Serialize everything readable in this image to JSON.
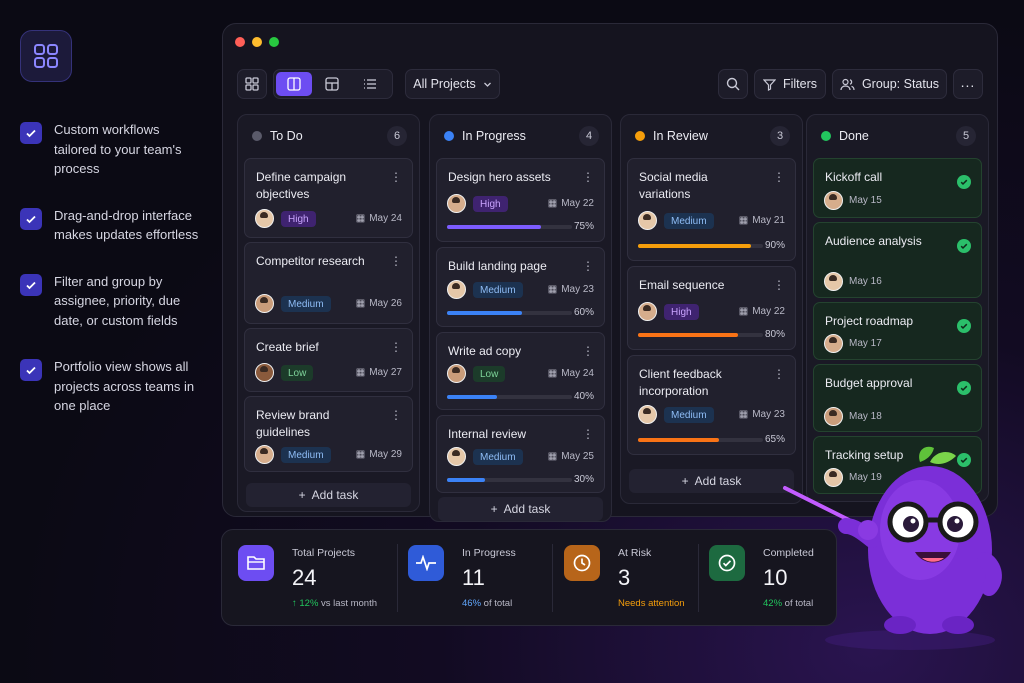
{
  "features": [
    {
      "text": "Custom workflows tailored to your team's process"
    },
    {
      "text": "Drag-and-drop interface makes updates effortless"
    },
    {
      "text": "Filter and group by assignee, priority, due date, or custom fields"
    },
    {
      "text": "Portfolio view shows all projects across teams in one place"
    }
  ],
  "toolbar": {
    "project_select": "All Projects",
    "filters_label": "Filters",
    "group_label": "Group: Status"
  },
  "columns": [
    {
      "title": "To Do",
      "count": "6",
      "color": "#5a5a6a",
      "add_label": "Add task",
      "cards": [
        {
          "title": "Define campaign objectives",
          "priority": "High",
          "due": "May 24"
        },
        {
          "title": "Competitor research",
          "priority": "Medium",
          "due": "May 26"
        },
        {
          "title": "Create brief",
          "priority": "Low",
          "due": "May 27"
        },
        {
          "title": "Review brand guidelines",
          "priority": "Medium",
          "due": "May 29"
        }
      ]
    },
    {
      "title": "In Progress",
      "count": "4",
      "color": "#3b82f6",
      "add_label": "Add task",
      "cards": [
        {
          "title": "Design hero assets",
          "priority": "High",
          "due": "May 22",
          "progress": "75%"
        },
        {
          "title": "Build landing page",
          "priority": "Medium",
          "due": "May 23",
          "progress": "60%"
        },
        {
          "title": "Write ad copy",
          "priority": "Low",
          "due": "May 24",
          "progress": "40%"
        },
        {
          "title": "Internal review",
          "priority": "Medium",
          "due": "May 25",
          "progress": "30%"
        }
      ]
    },
    {
      "title": "In Review",
      "count": "3",
      "color": "#f59e0b",
      "add_label": "Add task",
      "cards": [
        {
          "title": "Social media variations",
          "priority": "Medium",
          "due": "May 21",
          "progress": "90%"
        },
        {
          "title": "Email sequence",
          "priority": "High",
          "due": "May 22",
          "progress": "80%"
        },
        {
          "title": "Client feedback incorporation",
          "priority": "Medium",
          "due": "May 23",
          "progress": "65%"
        }
      ]
    },
    {
      "title": "Done",
      "count": "5",
      "color": "#22c55e",
      "cards": [
        {
          "title": "Kickoff call",
          "due": "May 15"
        },
        {
          "title": "Audience analysis",
          "due": "May 16"
        },
        {
          "title": "Project roadmap",
          "due": "May 17"
        },
        {
          "title": "Budget approval",
          "due": "May 18"
        },
        {
          "title": "Tracking setup",
          "due": "May 19"
        }
      ]
    }
  ],
  "stats": [
    {
      "label": "Total Projects",
      "value": "24",
      "sub_accent": "↑ 12%",
      "sub_rest": " vs last month",
      "color": "#6d4df2",
      "accent_color": "#22c55e",
      "icon": "folder-icon"
    },
    {
      "label": "In Progress",
      "value": "11",
      "sub_accent": "46%",
      "sub_rest": " of total",
      "color": "#2f5bd8",
      "accent_color": "#60a5fa",
      "icon": "activity-icon"
    },
    {
      "label": "At Risk",
      "value": "3",
      "sub_accent": "Needs attention",
      "sub_rest": "",
      "color": "#b7651a",
      "accent_color": "#f59e0b",
      "icon": "clock-icon"
    },
    {
      "label": "Completed",
      "value": "10",
      "sub_accent": "42%",
      "sub_rest": " of total",
      "color": "#1d6a40",
      "accent_color": "#22c55e",
      "icon": "check-circle-icon"
    }
  ]
}
